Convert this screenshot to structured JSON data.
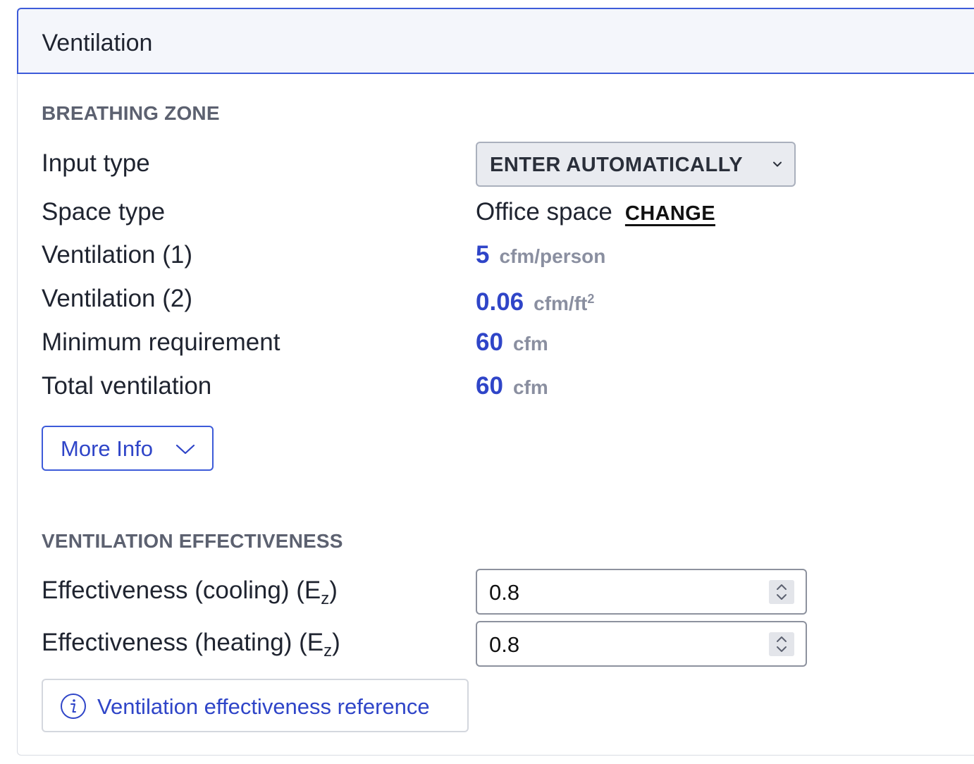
{
  "panel": {
    "title": "Ventilation"
  },
  "breathing_zone": {
    "heading": "BREATHING ZONE",
    "input_type": {
      "label": "Input type",
      "selected": "ENTER AUTOMATICALLY"
    },
    "space_type": {
      "label": "Space type",
      "value": "Office space",
      "change_label": "CHANGE"
    },
    "ventilation_1": {
      "label": "Ventilation (1)",
      "value": "5",
      "unit": "cfm/person"
    },
    "ventilation_2": {
      "label": "Ventilation (2)",
      "value": "0.06",
      "unit": "cfm/ft",
      "unit_sup": "2"
    },
    "minimum_requirement": {
      "label": "Minimum requirement",
      "value": "60",
      "unit": "cfm"
    },
    "total_ventilation": {
      "label": "Total ventilation",
      "value": "60",
      "unit": "cfm"
    },
    "more_info_label": "More Info"
  },
  "effectiveness": {
    "heading": "VENTILATION EFFECTIVENESS",
    "cooling": {
      "label": "Effectiveness (cooling) (E",
      "sub": "z",
      "label_end": ")",
      "value": "0.8"
    },
    "heating": {
      "label": "Effectiveness (heating) (E",
      "sub": "z",
      "label_end": ")",
      "value": "0.8"
    },
    "reference_label": "Ventilation effectiveness reference"
  },
  "colors": {
    "accent": "#2f45c8",
    "header_border": "#3d5bd9",
    "header_bg": "#f4f6fb",
    "unit_gray": "#8a8fa0"
  },
  "icons": {
    "select_chevron": "chevron-down-icon",
    "more_info_chevron": "chevron-down-icon",
    "spinner": "spinner-arrows-icon",
    "reference": "info-circle-icon"
  }
}
